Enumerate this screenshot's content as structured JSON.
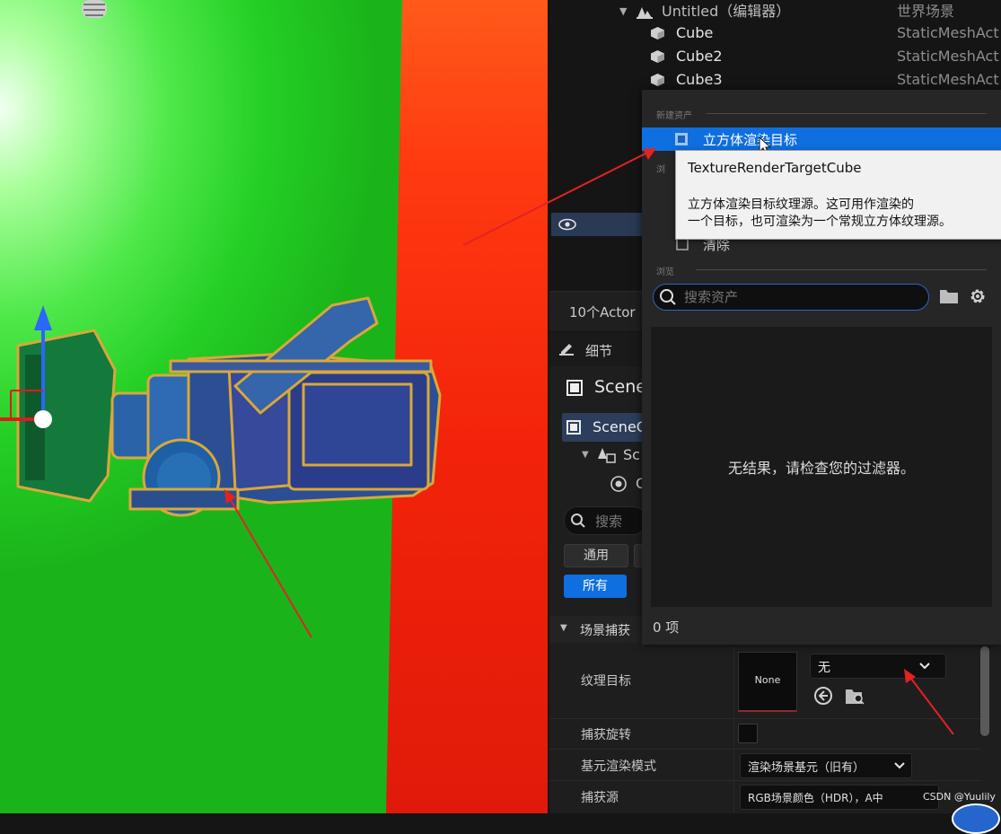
{
  "outliner": {
    "root": {
      "name": "Untitled（编辑器）",
      "type": "世界场景"
    },
    "items": [
      {
        "name": "Cube",
        "type": "StaticMeshAct"
      },
      {
        "name": "Cube2",
        "type": "StaticMeshAct"
      },
      {
        "name": "Cube3",
        "type": "StaticMeshAct"
      }
    ],
    "actor_count": "10个Actor"
  },
  "picker": {
    "section_new": "新建资产",
    "selected_item": "立方体渲染目标",
    "hidden_item": "清除",
    "section_browse": "浏览",
    "search_placeholder": "搜索资产",
    "empty_message": "无结果，请检查您的过滤器。",
    "item_count": "0 项"
  },
  "tooltip": {
    "title": "TextureRenderTargetCube",
    "line1": "立方体渲染目标纹理源。这可用作渲染的",
    "line2": "一个目标，也可渲染为一个常规立方体纹理源。"
  },
  "details": {
    "tab_title": "细节",
    "object_name": "Scene",
    "component_root": "SceneC",
    "tree_child1": "Sc",
    "tree_child2": "C",
    "search_placeholder": "搜索",
    "filter_general": "通用",
    "filter_all": "所有",
    "category": "场景捕获",
    "rows": {
      "texture_target": {
        "label": "纹理目标",
        "thumb": "None",
        "value": "无"
      },
      "capture_rotation": {
        "label": "捕获旋转"
      },
      "primitive_mode": {
        "label": "基元渲染模式",
        "value": "渲染场景基元（旧有）"
      },
      "capture_source": {
        "label": "捕获源",
        "value": "RGB场景颜色（HDR），A中"
      }
    }
  },
  "watermark": "CSDN @Yuulily",
  "colors": {
    "accent": "#0f6fe0",
    "arrow": "#e32222",
    "green_screen": "#2bd22b",
    "red_screen": "#f2230a"
  }
}
